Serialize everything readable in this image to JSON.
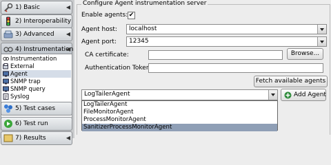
{
  "sidebar": {
    "items": [
      {
        "label": "1) Basic"
      },
      {
        "label": "2) Interoperability"
      },
      {
        "label": "3) Advanced"
      },
      {
        "label": "4) Instrumentation"
      },
      {
        "label": "5) Test cases"
      },
      {
        "label": "6) Test run"
      },
      {
        "label": "7) Results"
      }
    ],
    "subitems": [
      {
        "label": "Instrumentation"
      },
      {
        "label": "External"
      },
      {
        "label": "Agent"
      },
      {
        "label": "SNMP trap"
      },
      {
        "label": "SNMP query"
      },
      {
        "label": "Syslog"
      }
    ],
    "selected_subitem": "Agent"
  },
  "panel": {
    "title": "Configure Agent instrumentation server",
    "enable_label": "Enable agents:",
    "enable_checked": "✔",
    "host_label": "Agent host:",
    "host_value": "localhost",
    "port_label": "Agent port:",
    "port_value": "12345",
    "ca_label": "CA certificate:",
    "ca_value": "",
    "browse_label": "Browse...",
    "token_label": "Authentication Token:",
    "token_value": "",
    "fetch_label": "Fetch available agents",
    "agent_selected": "LogTailerAgent",
    "add_label": "Add Agent",
    "agent_options": [
      "LogTailerAgent",
      "FileMonitorAgent",
      "ProcessMonitorAgent",
      "SanitizerProcessMonitorAgent"
    ],
    "highlighted_option": "SanitizerProcessMonitorAgent"
  },
  "colors": {
    "selection": "#8f9fb6",
    "add_icon": "#2e8b3a"
  }
}
